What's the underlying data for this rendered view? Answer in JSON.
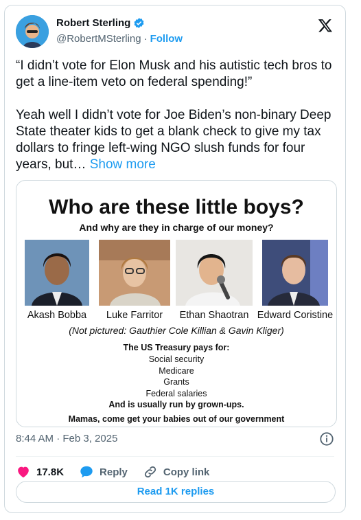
{
  "author": {
    "name": "Robert Sterling",
    "handle": "@RobertMSterling",
    "separator": "·",
    "follow_label": "Follow"
  },
  "tweet": {
    "text": "“I didn’t vote for Elon Musk and his autistic tech bros to get a line-item veto on federal spending!”\n\nYeah well I didn’t vote for Joe Biden’s non-binary Deep State theater kids to get a blank check to give my tax dollars to fringe left-wing NGO slush funds for four years, but…",
    "show_more": "Show more",
    "timestamp": "8:44 AM · Feb 3, 2025"
  },
  "media": {
    "title": "Who are these little boys?",
    "subtitle": "And why are they in charge of our money?",
    "people": [
      {
        "name": "Akash Bobba"
      },
      {
        "name": "Luke Farritor"
      },
      {
        "name": "Ethan Shaotran"
      },
      {
        "name": "Edward Coristine"
      }
    ],
    "not_pictured": "(Not pictured: Gauthier Cole Killian & Gavin Kliger)",
    "treasury_heading": "The US Treasury pays for:",
    "treasury_items": [
      "Social security",
      "Medicare",
      "Grants",
      "Federal salaries"
    ],
    "grownups": "And is usually run by grown-ups.",
    "footer": "Mamas, come get your babies out of our government"
  },
  "actions": {
    "likes": "17.8K",
    "reply": "Reply",
    "copy_link": "Copy link",
    "read_replies": "Read 1K replies"
  },
  "colors": {
    "accent": "#1d9bf0",
    "like": "#f91880",
    "muted": "#536471"
  }
}
